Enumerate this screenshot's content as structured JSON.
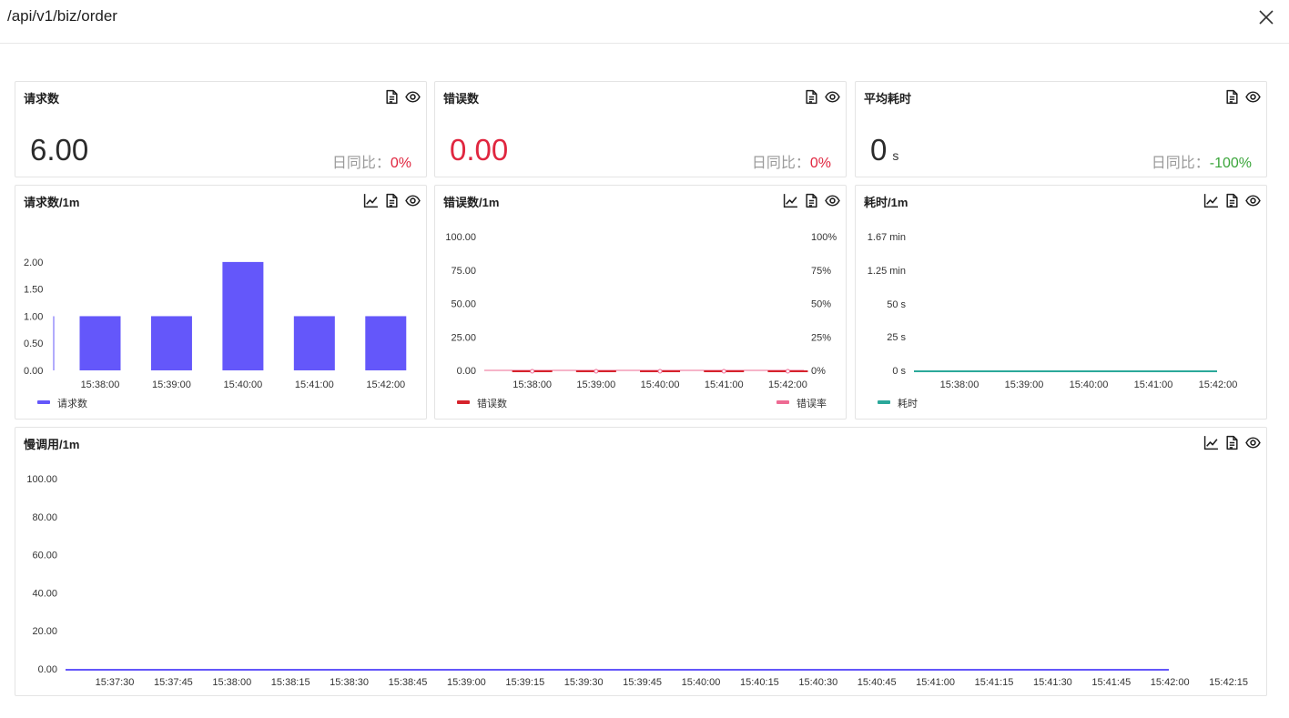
{
  "window": {
    "title": "/api/v1/biz/order"
  },
  "icons": {
    "close": "close-icon",
    "trend": "line-chart-icon",
    "doc": "document-icon",
    "view": "eye-icon"
  },
  "stats": [
    {
      "title": "请求数",
      "value": "6.00",
      "unit": "",
      "compare_label": "日同比：",
      "compare_value": "0%"
    },
    {
      "title": "错误数",
      "value": "0.00",
      "unit": "",
      "compare_label": "日同比：",
      "compare_value": "0%"
    },
    {
      "title": "平均耗时",
      "value": "0",
      "unit": "s",
      "compare_label": "日同比：",
      "compare_value": "-100%"
    }
  ],
  "colors": {
    "requests": "#6457fa",
    "errors": "#d6232c",
    "error_rate": "#ee6b93",
    "latency": "#2ba89a",
    "slow": "#6457fa",
    "red": "#e0263f",
    "green": "#3aa53a"
  },
  "charts": {
    "requests": {
      "title": "请求数/1m"
    },
    "errors": {
      "title": "错误数/1m"
    },
    "latency": {
      "title": "耗时/1m"
    },
    "slow": {
      "title": "慢调用/1m"
    }
  },
  "chart_data": [
    {
      "type": "bar",
      "title": "请求数/1m",
      "categories": [
        "15:38:00",
        "15:39:00",
        "15:40:00",
        "15:41:00",
        "15:42:00"
      ],
      "series": [
        {
          "name": "请求数",
          "values": [
            1,
            1,
            2,
            1,
            1
          ]
        }
      ],
      "ytick_labels": [
        "0.00",
        "0.50",
        "1.00",
        "1.50",
        "2.00"
      ],
      "ylim": [
        0,
        2.25
      ],
      "legend": "bottom-left"
    },
    {
      "type": "line",
      "title": "错误数/1m",
      "categories": [
        "15:38:00",
        "15:39:00",
        "15:40:00",
        "15:41:00",
        "15:42:00"
      ],
      "series": [
        {
          "name": "错误数",
          "values": [
            0,
            0,
            0,
            0,
            0
          ],
          "axis": "left"
        },
        {
          "name": "错误率",
          "values": [
            0,
            0,
            0,
            0,
            0
          ],
          "axis": "right"
        }
      ],
      "ytick_labels": [
        "0.00",
        "25.00",
        "50.00",
        "75.00",
        "100.00"
      ],
      "y2tick_labels": [
        "0%",
        "25%",
        "50%",
        "75%",
        "100%"
      ],
      "ylim": [
        0,
        100
      ],
      "y2lim": [
        0,
        100
      ],
      "legend": "bottom"
    },
    {
      "type": "line",
      "title": "耗时/1m",
      "categories": [
        "15:38:00",
        "15:39:00",
        "15:40:00",
        "15:41:00",
        "15:42:00"
      ],
      "series": [
        {
          "name": "耗时",
          "values": [
            0,
            0,
            0,
            0,
            0
          ]
        }
      ],
      "ytick_labels": [
        "0 s",
        "25 s",
        "50 s",
        "1.25 min",
        "1.67 min"
      ],
      "legend": "bottom-left"
    },
    {
      "type": "line",
      "title": "慢调用/1m",
      "x": [
        "15:37:30",
        "15:37:45",
        "15:38:00",
        "15:38:15",
        "15:38:30",
        "15:38:45",
        "15:39:00",
        "15:39:15",
        "15:39:30",
        "15:39:45",
        "15:40:00",
        "15:40:15",
        "15:40:30",
        "15:40:45",
        "15:41:00",
        "15:41:15",
        "15:41:30",
        "15:41:45",
        "15:42:00",
        "15:42:15"
      ],
      "series": [
        {
          "values": [
            0,
            0,
            0,
            0,
            0,
            0,
            0,
            0,
            0,
            0,
            0,
            0,
            0,
            0,
            0,
            0,
            0,
            0,
            0,
            0
          ]
        }
      ],
      "ytick_labels": [
        "0.00",
        "20.00",
        "40.00",
        "60.00",
        "80.00",
        "100.00"
      ],
      "ylim": [
        0,
        100
      ]
    }
  ]
}
